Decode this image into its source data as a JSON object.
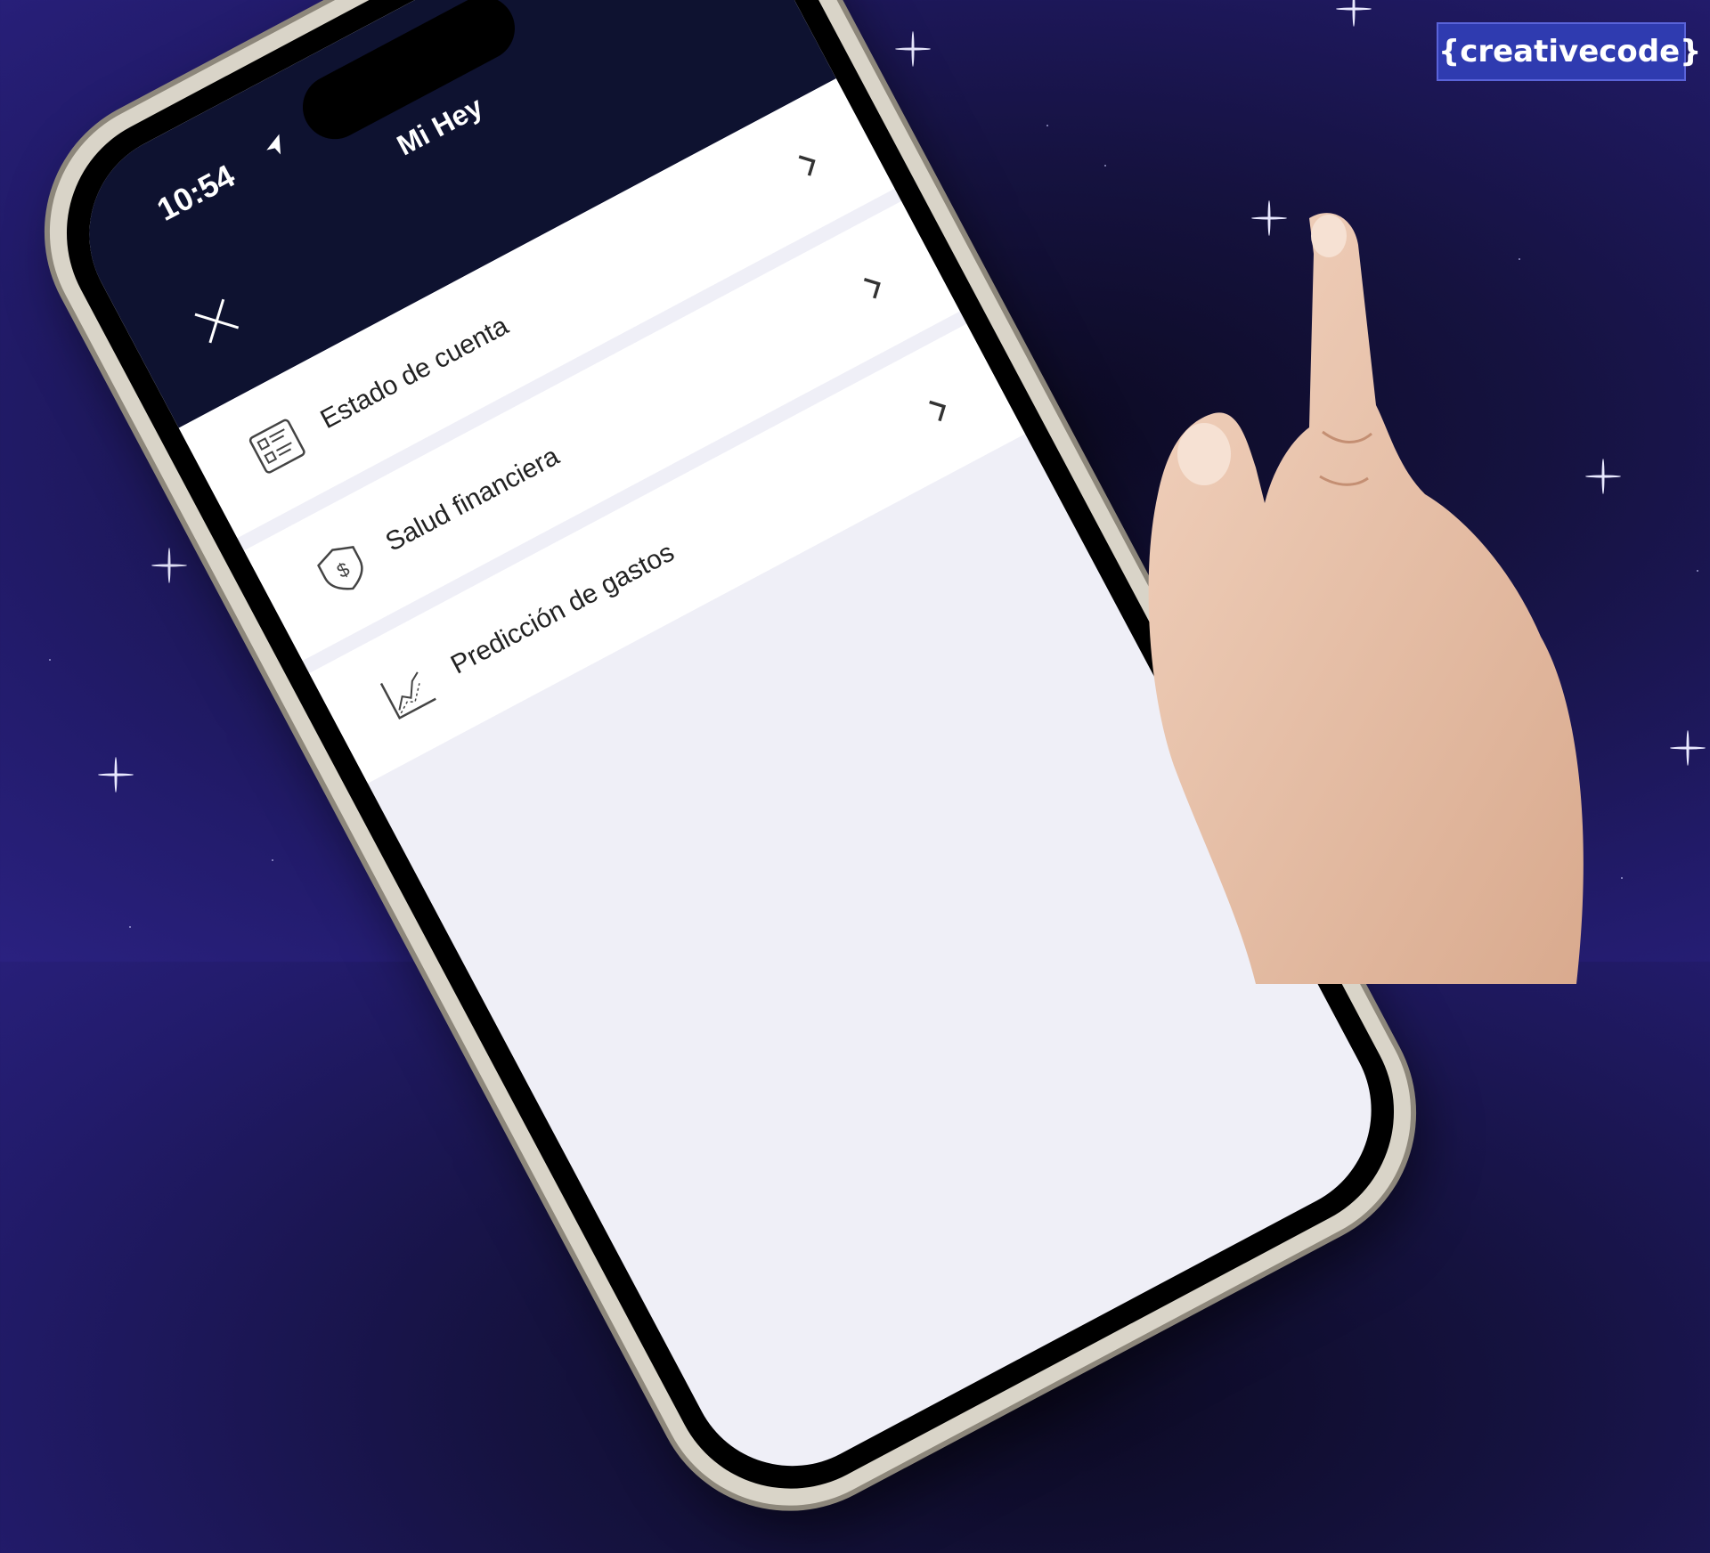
{
  "brand": {
    "label": "{creativecode}"
  },
  "status_bar": {
    "time": "10:54",
    "location_icon": "location-arrow-icon"
  },
  "header": {
    "title": "Mi Hey",
    "close_icon": "close-icon"
  },
  "menu": {
    "items": [
      {
        "label": "Estado de cuenta",
        "icon": "document-list-icon"
      },
      {
        "label": "Salud financiera",
        "icon": "shield-dollar-icon"
      },
      {
        "label": "Predicción de gastos",
        "icon": "trend-chart-icon"
      }
    ]
  },
  "colors": {
    "background": "#1a1650",
    "header": "#0e1230",
    "screen": "#efeff7",
    "brand_badge": "#2f3bb0"
  }
}
